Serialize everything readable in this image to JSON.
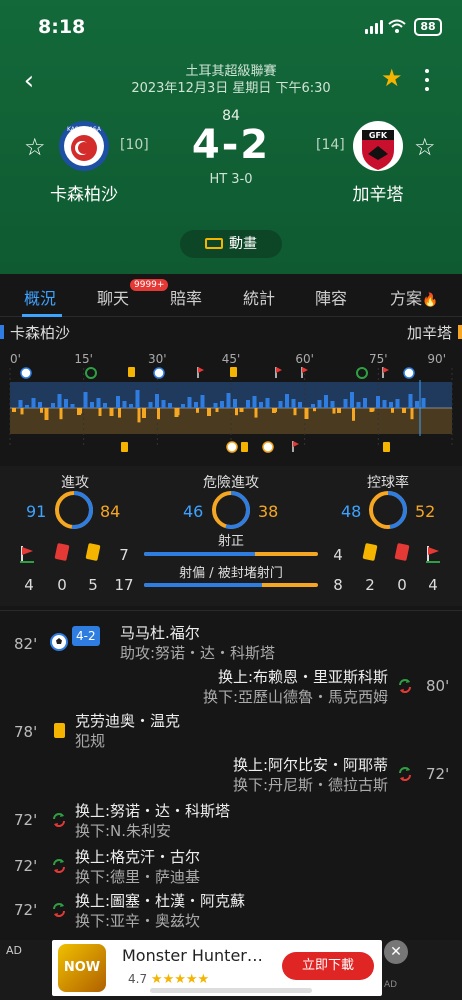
{
  "status": {
    "time": "8:18",
    "battery": "88"
  },
  "header": {
    "league": "土耳其超級聯賽",
    "datetime": "2023年12月3日 星期日 下午6:30",
    "minute": "84",
    "score": "4-2",
    "halftime": "HT 3-0",
    "home": {
      "name": "卡森柏沙",
      "rank": "[10]",
      "logo_text": "KASIMPASA",
      "color": "#2f7de1"
    },
    "away": {
      "name": "加辛塔",
      "rank": "[14]",
      "logo_text": "GFK",
      "color": "#f5a623"
    },
    "animation_label": "動畫"
  },
  "tabs": [
    {
      "label": "概況"
    },
    {
      "label": "聊天"
    },
    {
      "label": "賠率"
    },
    {
      "label": "統計"
    },
    {
      "label": "陣容"
    },
    {
      "label": "方案"
    }
  ],
  "chat_badge": "9999+",
  "timeline": {
    "home_label": "卡森柏沙",
    "away_label": "加辛塔",
    "ticks": [
      "0'",
      "15'",
      "30'",
      "45'",
      "60'",
      "75'",
      "90'"
    ]
  },
  "stats": {
    "attack": {
      "label": "進攻",
      "home": "91",
      "away": "84",
      "home_value": 91,
      "away_value": 84
    },
    "danger": {
      "label": "危險進攻",
      "home": "46",
      "away": "38",
      "home_value": 46,
      "away_value": 38
    },
    "possession": {
      "label": "控球率",
      "home": "48",
      "away": "52",
      "home_value": 48,
      "away_value": 52
    },
    "shots_on_label": "射正",
    "shots_off_label": "射偏 / 被封堵射门",
    "home_shots_on": "7",
    "away_shots_on": "4",
    "home_shots_off": "17",
    "away_shots_off": "8",
    "home_corners": "4",
    "home_red": "0",
    "home_yellow": "5",
    "away_yellow": "2",
    "away_red": "0",
    "away_corners": "4",
    "shots_on_home_share": 0.64,
    "shots_off_home_share": 0.68
  },
  "events": [
    {
      "minute": "82'",
      "side": "home",
      "type": "goal",
      "score": "4-2",
      "line1": "马马杜.福尔",
      "line2": "助攻:努诺・达・科斯塔"
    },
    {
      "minute": "80'",
      "side": "away",
      "type": "sub",
      "line1": "换上:布赖恩・里亚斯科斯",
      "line2": "换下:亞歷山德魯・馬克西姆"
    },
    {
      "minute": "78'",
      "side": "home",
      "type": "yellow",
      "line1": "克劳迪奥・温克",
      "line2": "犯规"
    },
    {
      "minute": "72'",
      "side": "away",
      "type": "sub",
      "line1": "换上:阿尔比安・阿耶蒂",
      "line2": "换下:丹尼斯・德拉古斯"
    },
    {
      "minute": "72'",
      "side": "home",
      "type": "sub",
      "line1": "换上:努诺・达・科斯塔",
      "line2": "换下:N.朱利安"
    },
    {
      "minute": "72'",
      "side": "home",
      "type": "sub",
      "line1": "换上:格克汗・古尔",
      "line2": "换下:德里・萨迪基"
    },
    {
      "minute": "72'",
      "side": "home",
      "type": "sub",
      "line1": "换上:圖塞・杜漢・阿克蘇",
      "line2": "换下:亚辛・奥兹坎"
    }
  ],
  "ad": {
    "tag": "AD",
    "icon_text": "NOW",
    "title": "Monster Hunter…",
    "rating": "4.7",
    "button": "立即下載",
    "close": "✕",
    "mark": "AD"
  }
}
